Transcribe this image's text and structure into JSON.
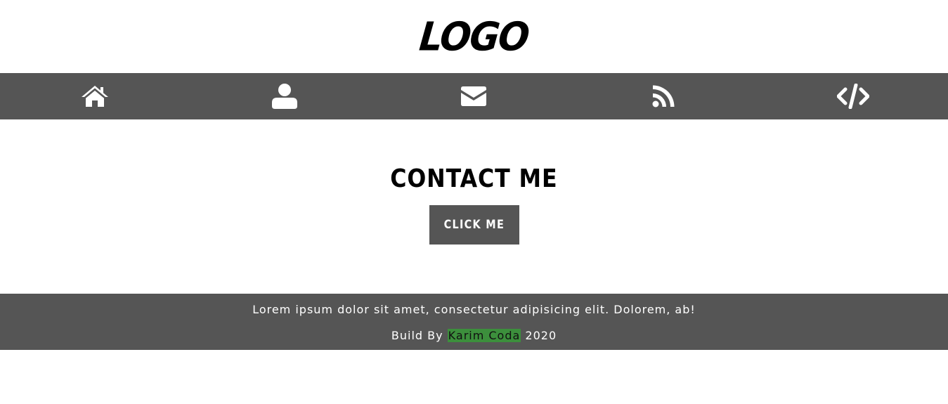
{
  "header": {
    "logo": "LOGO"
  },
  "nav": {
    "items": [
      {
        "icon": "home-icon"
      },
      {
        "icon": "user-icon"
      },
      {
        "icon": "envelope-icon"
      },
      {
        "icon": "rss-icon"
      },
      {
        "icon": "code-icon"
      }
    ]
  },
  "main": {
    "title": "CONTACT ME",
    "button_label": "CLICK ME"
  },
  "footer": {
    "text": "Lorem ipsum dolor sit amet, consectetur adipisicing elit. Dolorem, ab!",
    "build_prefix": "Build By",
    "author": "Karim Coda",
    "year": "2020"
  },
  "colors": {
    "bar_background": "#555555",
    "author_highlight": "#3c8f3c",
    "icon_color": "#ffffff"
  }
}
